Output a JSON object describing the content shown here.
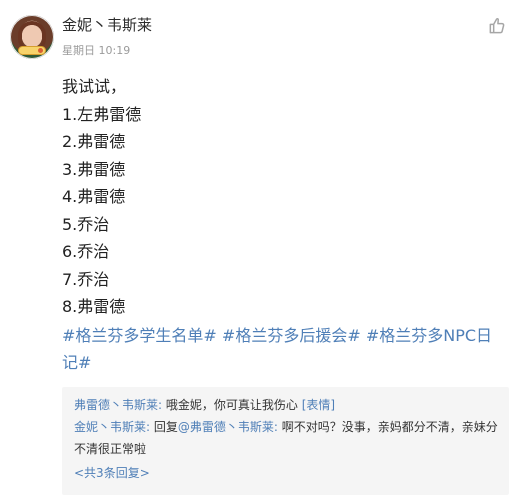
{
  "post": {
    "author": "金妮丶韦斯莱",
    "time": "星期日 10:19",
    "lines": [
      "我试试，",
      "1.左弗雷德",
      "2.弗雷德",
      "3.弗雷德",
      "4.弗雷德",
      "5.乔治",
      "6.乔治",
      "7.乔治",
      "8.弗雷德"
    ],
    "tags": [
      "#格兰芬多学生名单#",
      "#格兰芬多后援会#",
      "#格兰芬多NPC日记#"
    ]
  },
  "comments": {
    "first": {
      "name": "弗雷德丶韦斯莱:",
      "text": " 哦金妮，你可真让我伤心 ",
      "emoji": "[表情]"
    },
    "second": {
      "name": "金妮丶韦斯莱:",
      "prefix": " 回复",
      "mention": "@弗雷德丶韦斯莱:",
      "text": " 啊不对吗？没事，亲妈都分不清，亲妹分不清很正常啦"
    },
    "more": "<共3条回复>"
  },
  "icons": {
    "avatar": "avatar-icon",
    "like": "thumb-up-icon"
  },
  "colors": {
    "link": "#4f7fb7",
    "meta": "#9b9b9b",
    "comment_bg": "#f5f5f5"
  }
}
